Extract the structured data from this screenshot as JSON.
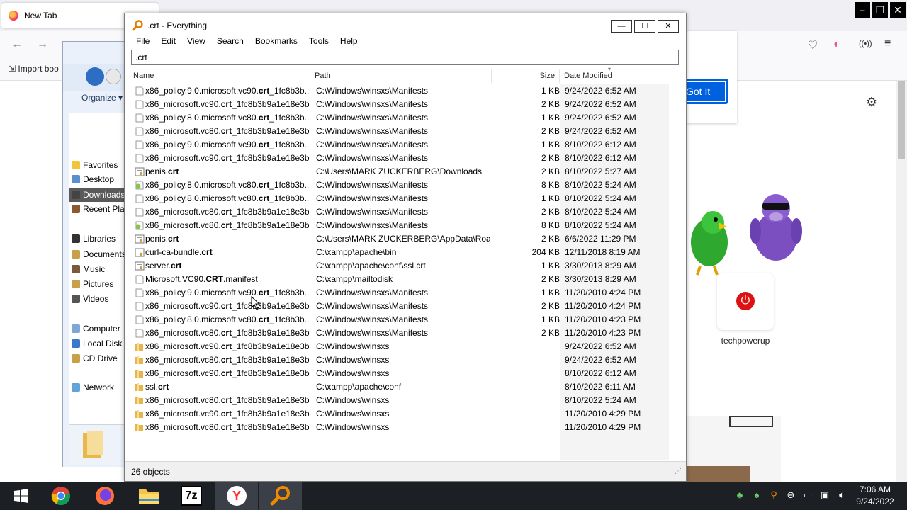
{
  "browser": {
    "tab_title": "New Tab",
    "import_bookmarks": "Import boo",
    "got_it_label": "Got It",
    "shortcut_label": "techpowerup"
  },
  "explorer": {
    "organize": "Organize",
    "tree": [
      {
        "label": "Favorites",
        "icon": "star-icon",
        "color": "#f2c53d"
      },
      {
        "label": "Desktop",
        "icon": "desktop-icon",
        "color": "#5a8fd0"
      },
      {
        "label": "Downloads",
        "icon": "downloads-folder-icon",
        "color": "#444"
      },
      {
        "label": "Recent Places",
        "icon": "recent-icon",
        "color": "#8a5a2e"
      },
      {
        "label": "Libraries",
        "icon": "libraries-icon",
        "color": "#333"
      },
      {
        "label": "Documents",
        "icon": "documents-icon",
        "color": "#c9a04a"
      },
      {
        "label": "Music",
        "icon": "music-icon",
        "color": "#7a5a3a"
      },
      {
        "label": "Pictures",
        "icon": "pictures-icon",
        "color": "#c9a04a"
      },
      {
        "label": "Videos",
        "icon": "videos-icon",
        "color": "#555"
      },
      {
        "label": "Computer",
        "icon": "computer-icon",
        "color": "#7fa7d6"
      },
      {
        "label": "Local Disk",
        "icon": "disk-icon",
        "color": "#3c78c8"
      },
      {
        "label": "CD Drive",
        "icon": "cd-icon",
        "color": "#c9a04a"
      },
      {
        "label": "Network",
        "icon": "network-icon",
        "color": "#5fa5d8"
      }
    ]
  },
  "everything": {
    "title": ".crt - Everything",
    "menu": [
      "File",
      "Edit",
      "View",
      "Search",
      "Bookmarks",
      "Tools",
      "Help"
    ],
    "search_value": ".crt",
    "columns": {
      "name": "Name",
      "path": "Path",
      "size": "Size",
      "date": "Date Modified"
    },
    "rows": [
      {
        "pre": "x86_policy.9.0.microsoft.vc90.",
        "bold": "crt",
        "post": "_1fc8b3b...",
        "path": "C:\\Windows\\winsxs\\Manifests",
        "size": "1 KB",
        "date": "9/24/2022 6:52 AM",
        "icon": "manifest"
      },
      {
        "pre": "x86_microsoft.vc90.",
        "bold": "crt",
        "post": "_1fc8b3b9a1e18e3b...",
        "path": "C:\\Windows\\winsxs\\Manifests",
        "size": "2 KB",
        "date": "9/24/2022 6:52 AM",
        "icon": "manifest"
      },
      {
        "pre": "x86_policy.8.0.microsoft.vc80.",
        "bold": "crt",
        "post": "_1fc8b3b...",
        "path": "C:\\Windows\\winsxs\\Manifests",
        "size": "1 KB",
        "date": "9/24/2022 6:52 AM",
        "icon": "manifest"
      },
      {
        "pre": "x86_microsoft.vc80.",
        "bold": "crt",
        "post": "_1fc8b3b9a1e18e3b...",
        "path": "C:\\Windows\\winsxs\\Manifests",
        "size": "2 KB",
        "date": "9/24/2022 6:52 AM",
        "icon": "manifest"
      },
      {
        "pre": "x86_policy.9.0.microsoft.vc90.",
        "bold": "crt",
        "post": "_1fc8b3b...",
        "path": "C:\\Windows\\winsxs\\Manifests",
        "size": "1 KB",
        "date": "8/10/2022 6:12 AM",
        "icon": "manifest"
      },
      {
        "pre": "x86_microsoft.vc90.",
        "bold": "crt",
        "post": "_1fc8b3b9a1e18e3b...",
        "path": "C:\\Windows\\winsxs\\Manifests",
        "size": "2 KB",
        "date": "8/10/2022 6:12 AM",
        "icon": "manifest"
      },
      {
        "pre": "penis.",
        "bold": "crt",
        "post": "",
        "path": "C:\\Users\\MARK ZUCKERBERG\\Downloads",
        "size": "2 KB",
        "date": "8/10/2022 5:27 AM",
        "icon": "cert"
      },
      {
        "pre": "x86_policy.8.0.microsoft.vc80.",
        "bold": "crt",
        "post": "_1fc8b3b...",
        "path": "C:\\Windows\\winsxs\\Manifests",
        "size": "8 KB",
        "date": "8/10/2022 5:24 AM",
        "icon": "catalog"
      },
      {
        "pre": "x86_policy.8.0.microsoft.vc80.",
        "bold": "crt",
        "post": "_1fc8b3b...",
        "path": "C:\\Windows\\winsxs\\Manifests",
        "size": "1 KB",
        "date": "8/10/2022 5:24 AM",
        "icon": "manifest"
      },
      {
        "pre": "x86_microsoft.vc80.",
        "bold": "crt",
        "post": "_1fc8b3b9a1e18e3b...",
        "path": "C:\\Windows\\winsxs\\Manifests",
        "size": "2 KB",
        "date": "8/10/2022 5:24 AM",
        "icon": "manifest"
      },
      {
        "pre": "x86_microsoft.vc80.",
        "bold": "crt",
        "post": "_1fc8b3b9a1e18e3b...",
        "path": "C:\\Windows\\winsxs\\Manifests",
        "size": "8 KB",
        "date": "8/10/2022 5:24 AM",
        "icon": "catalog"
      },
      {
        "pre": "penis.",
        "bold": "crt",
        "post": "",
        "path": "C:\\Users\\MARK ZUCKERBERG\\AppData\\Roa...",
        "size": "2 KB",
        "date": "6/6/2022 11:29 PM",
        "icon": "cert"
      },
      {
        "pre": "curl-ca-bundle.",
        "bold": "crt",
        "post": "",
        "path": "C:\\xampp\\apache\\bin",
        "size": "204 KB",
        "date": "12/11/2018 8:19 AM",
        "icon": "cert"
      },
      {
        "pre": "server.",
        "bold": "crt",
        "post": "",
        "path": "C:\\xampp\\apache\\conf\\ssl.crt",
        "size": "1 KB",
        "date": "3/30/2013 8:29 AM",
        "icon": "cert"
      },
      {
        "pre": "Microsoft.VC90.",
        "bold": "CRT",
        "post": ".manifest",
        "path": "C:\\xampp\\mailtodisk",
        "size": "2 KB",
        "date": "3/30/2013 8:29 AM",
        "icon": "manifest"
      },
      {
        "pre": "x86_policy.9.0.microsoft.vc90.",
        "bold": "crt",
        "post": "_1fc8b3b...",
        "path": "C:\\Windows\\winsxs\\Manifests",
        "size": "1 KB",
        "date": "11/20/2010 4:24 PM",
        "icon": "manifest"
      },
      {
        "pre": "x86_microsoft.vc90.",
        "bold": "crt",
        "post": "_1fc8b3b9a1e18e3b...",
        "path": "C:\\Windows\\winsxs\\Manifests",
        "size": "2 KB",
        "date": "11/20/2010 4:24 PM",
        "icon": "manifest"
      },
      {
        "pre": "x86_policy.8.0.microsoft.vc80.",
        "bold": "crt",
        "post": "_1fc8b3b...",
        "path": "C:\\Windows\\winsxs\\Manifests",
        "size": "1 KB",
        "date": "11/20/2010 4:23 PM",
        "icon": "manifest"
      },
      {
        "pre": "x86_microsoft.vc80.",
        "bold": "crt",
        "post": "_1fc8b3b9a1e18e3b...",
        "path": "C:\\Windows\\winsxs\\Manifests",
        "size": "2 KB",
        "date": "11/20/2010 4:23 PM",
        "icon": "manifest"
      },
      {
        "pre": "x86_microsoft.vc90.",
        "bold": "crt",
        "post": "_1fc8b3b9a1e18e3b...",
        "path": "C:\\Windows\\winsxs",
        "size": "",
        "date": "9/24/2022 6:52 AM",
        "icon": "folder"
      },
      {
        "pre": "x86_microsoft.vc80.",
        "bold": "crt",
        "post": "_1fc8b3b9a1e18e3b...",
        "path": "C:\\Windows\\winsxs",
        "size": "",
        "date": "9/24/2022 6:52 AM",
        "icon": "folder"
      },
      {
        "pre": "x86_microsoft.vc90.",
        "bold": "crt",
        "post": "_1fc8b3b9a1e18e3b...",
        "path": "C:\\Windows\\winsxs",
        "size": "",
        "date": "8/10/2022 6:12 AM",
        "icon": "folder"
      },
      {
        "pre": "ssl.",
        "bold": "crt",
        "post": "",
        "path": "C:\\xampp\\apache\\conf",
        "size": "",
        "date": "8/10/2022 6:11 AM",
        "icon": "folder"
      },
      {
        "pre": "x86_microsoft.vc80.",
        "bold": "crt",
        "post": "_1fc8b3b9a1e18e3b...",
        "path": "C:\\Windows\\winsxs",
        "size": "",
        "date": "8/10/2022 5:24 AM",
        "icon": "folder"
      },
      {
        "pre": "x86_microsoft.vc90.",
        "bold": "crt",
        "post": "_1fc8b3b9a1e18e3b...",
        "path": "C:\\Windows\\winsxs",
        "size": "",
        "date": "11/20/2010 4:29 PM",
        "icon": "folder"
      },
      {
        "pre": "x86_microsoft.vc80.",
        "bold": "crt",
        "post": "_1fc8b3b9a1e18e3b...",
        "path": "C:\\Windows\\winsxs",
        "size": "",
        "date": "11/20/2010 4:29 PM",
        "icon": "folder"
      }
    ],
    "status": "26 objects"
  },
  "taskbar": {
    "apps": [
      {
        "name": "start-button",
        "icon": "windows-icon"
      },
      {
        "name": "taskbar-chrome",
        "icon": "chrome-icon"
      },
      {
        "name": "taskbar-firefox",
        "icon": "firefox-icon"
      },
      {
        "name": "taskbar-file-explorer",
        "icon": "folder-icon"
      },
      {
        "name": "taskbar-7zip",
        "icon": "7zip-icon",
        "label": "7z"
      },
      {
        "name": "taskbar-yandex",
        "icon": "yandex-icon",
        "label": "Y"
      },
      {
        "name": "taskbar-everything",
        "icon": "everything-search-icon"
      }
    ],
    "time": "7:06 AM",
    "date": "9/24/2022"
  }
}
